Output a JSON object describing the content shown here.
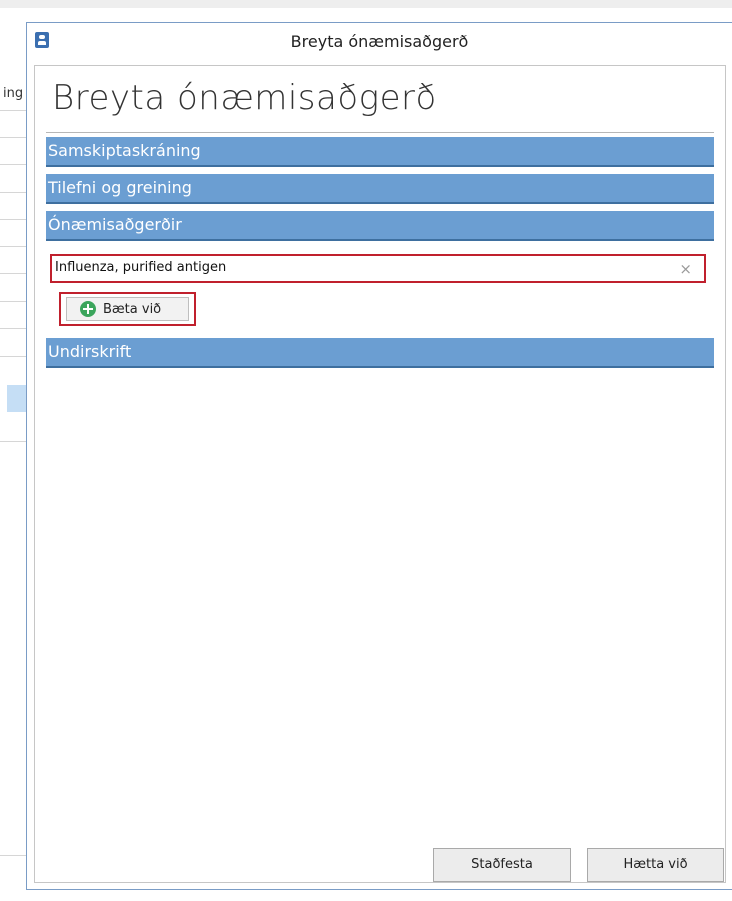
{
  "background": {
    "side_fragment": "ing"
  },
  "dialog": {
    "window_title": "Breyta ónæmisaðgerð",
    "page_title": "Breyta ónæmisaðgerð",
    "sections": [
      "Samskiptaskráning",
      "Tilefni og greining",
      "Ónæmisaðgerðir",
      "Undirskrift"
    ],
    "vaccination": {
      "value": "Influenza, purified antigen",
      "clear_icon": "×"
    },
    "add_button_label": "Bæta við",
    "confirm_label": "Staðfesta",
    "cancel_label": "Hætta við"
  },
  "colors": {
    "section_bar": "#6b9ed2",
    "highlight_border": "#c0202d",
    "add_icon": "#3ba55c"
  },
  "icons": {
    "title": "person-badge-icon",
    "add": "plus-circle-icon",
    "clear": "close-icon"
  }
}
